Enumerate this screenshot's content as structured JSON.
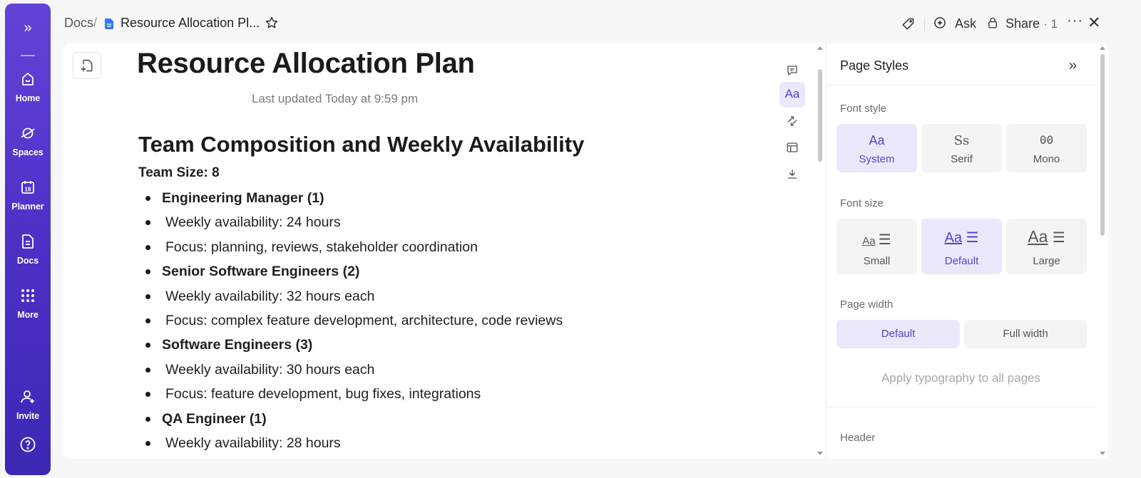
{
  "sidebar": {
    "items": [
      {
        "label": "Home",
        "icon": "home-icon"
      },
      {
        "label": "Spaces",
        "icon": "spaces-icon"
      },
      {
        "label": "Planner",
        "icon": "calendar-icon"
      },
      {
        "label": "Docs",
        "icon": "doc-icon"
      },
      {
        "label": "More",
        "icon": "grid-icon"
      }
    ],
    "invite_label": "Invite",
    "calendar_day": "18"
  },
  "breadcrumb": {
    "root": "Docs",
    "separator": "/",
    "current": "Resource Allocation Pl..."
  },
  "header": {
    "ask_label": "Ask",
    "share_label": "Share",
    "share_count": "· 1"
  },
  "document": {
    "title": "Resource Allocation Plan",
    "last_updated": "Last updated Today at 9:59 pm",
    "section_heading": "Team Composition and Weekly Availability",
    "team_size": "Team Size: 8",
    "items": [
      {
        "text": "Engineering Manager (1)",
        "bold": true
      },
      {
        "text": "Weekly availability: 24 hours",
        "bold": false
      },
      {
        "text": "Focus: planning, reviews, stakeholder coordination",
        "bold": false
      },
      {
        "text": "Senior Software Engineers (2)",
        "bold": true
      },
      {
        "text": "Weekly availability: 32 hours each",
        "bold": false
      },
      {
        "text": "Focus: complex feature development, architecture, code reviews",
        "bold": false
      },
      {
        "text": "Software Engineers (3)",
        "bold": true
      },
      {
        "text": "Weekly availability: 30 hours each",
        "bold": false
      },
      {
        "text": "Focus: feature development, bug fixes, integrations",
        "bold": false
      },
      {
        "text": "QA Engineer (1)",
        "bold": true
      },
      {
        "text": "Weekly availability: 28 hours",
        "bold": false
      }
    ]
  },
  "doc_toolbar": {
    "typography_label": "Aa"
  },
  "page_styles": {
    "title": "Page Styles",
    "font_style_label": "Font style",
    "font_styles": [
      {
        "glyph": "Aa",
        "label": "System",
        "selected": true
      },
      {
        "glyph": "Ss",
        "label": "Serif",
        "selected": false
      },
      {
        "glyph": "00",
        "label": "Mono",
        "selected": false
      }
    ],
    "font_size_label": "Font size",
    "font_sizes": [
      {
        "glyph": "Aa",
        "label": "Small",
        "selected": false
      },
      {
        "glyph": "Aa",
        "label": "Default",
        "selected": true
      },
      {
        "glyph": "Aa",
        "label": "Large",
        "selected": false
      }
    ],
    "page_width_label": "Page width",
    "page_widths": [
      {
        "label": "Default",
        "selected": true
      },
      {
        "label": "Full width",
        "selected": false
      }
    ],
    "apply_label": "Apply typography to all pages",
    "header_label": "Header"
  },
  "colors": {
    "accent": "#5b3fd0",
    "accent_soft": "#ece8fb",
    "rail_top": "#6243d8",
    "rail_bottom": "#3d28b5"
  }
}
